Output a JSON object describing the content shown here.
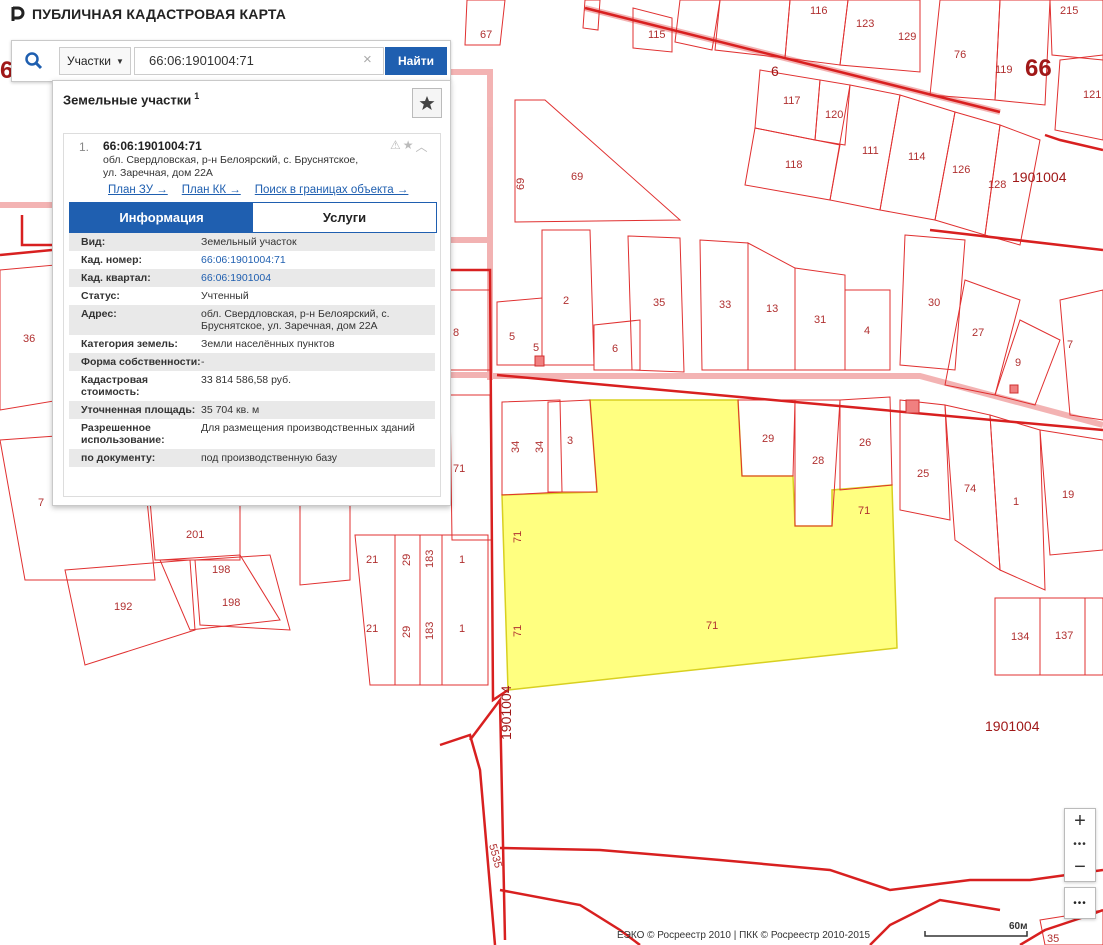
{
  "app": {
    "title": "ПУБЛИЧНАЯ КАДАСТРОВАЯ КАРТА"
  },
  "search": {
    "type_label": "Участки",
    "query": "66:06:1901004:71",
    "button_label": "Найти"
  },
  "panel": {
    "title": "Земельные участки",
    "count": "1",
    "result": {
      "index": "1.",
      "cadastral_number": "66:06:1901004:71",
      "address_line1": "обл. Свердловская, р-н Белоярский, с. Бруснятское,",
      "address_line2": "ул. Заречная, дом 22А",
      "links": [
        "План ЗУ →",
        "План КК →",
        "Поиск в границах объекта →"
      ],
      "tabs": [
        "Информация",
        "Услуги"
      ],
      "info": [
        {
          "key": "Вид:",
          "value": "Земельный участок"
        },
        {
          "key": "Кад. номер:",
          "value": "66:06:1901004:71"
        },
        {
          "key": "Кад. квартал:",
          "value": "66:06:1901004"
        },
        {
          "key": "Статус:",
          "value": "Учтенный"
        },
        {
          "key": "Адрес:",
          "value": "обл. Свердловская, р-н Белоярский, с. Бруснятское, ул. Заречная, дом 22А"
        },
        {
          "key": "Категория земель:",
          "value": "Земли населённых пунктов"
        },
        {
          "key": "Форма собственности:",
          "value": "-"
        },
        {
          "key": "Кадастровая стоимость:",
          "value": "33 814 586,58 руб."
        },
        {
          "key": "Уточненная площадь:",
          "value": "35 704 кв. м"
        },
        {
          "key": "Разрешенное использование:",
          "value": "Для размещения производственных зданий"
        },
        {
          "key": "по документу:",
          "value": "под производственную базу"
        }
      ]
    }
  },
  "map": {
    "quarter_labels": [
      "1901004",
      "1901004",
      "1901004",
      "66",
      "6"
    ],
    "road_label": "5535",
    "parcel_labels": [
      "67",
      "115",
      "116",
      "123",
      "129",
      "76",
      "119",
      "215",
      "121",
      "117",
      "120",
      "118",
      "111",
      "114",
      "126",
      "128",
      "69",
      "69",
      "2",
      "35",
      "33",
      "13",
      "31",
      "4",
      "30",
      "27",
      "9",
      "7",
      "5",
      "5",
      "6",
      "36",
      "8",
      "34",
      "34",
      "3",
      "29",
      "28",
      "26",
      "71",
      "25",
      "74",
      "1",
      "19",
      "71",
      "71",
      "71",
      "71",
      "7",
      "201",
      "198",
      "198",
      "192",
      "21",
      "29",
      "183",
      "1",
      "21",
      "29",
      "183",
      "1",
      "134",
      "137",
      "35"
    ],
    "highlight_color": "#ffff80",
    "boundary_color": "#e03030"
  },
  "controls": {
    "zoom_in": "+",
    "zoom_out": "−",
    "dots": "•••"
  },
  "footer": {
    "attribution": "ЕЭКО © Росреестр 2010 | ПКК © Росреестр 2010-2015",
    "scale_label": "60м"
  }
}
